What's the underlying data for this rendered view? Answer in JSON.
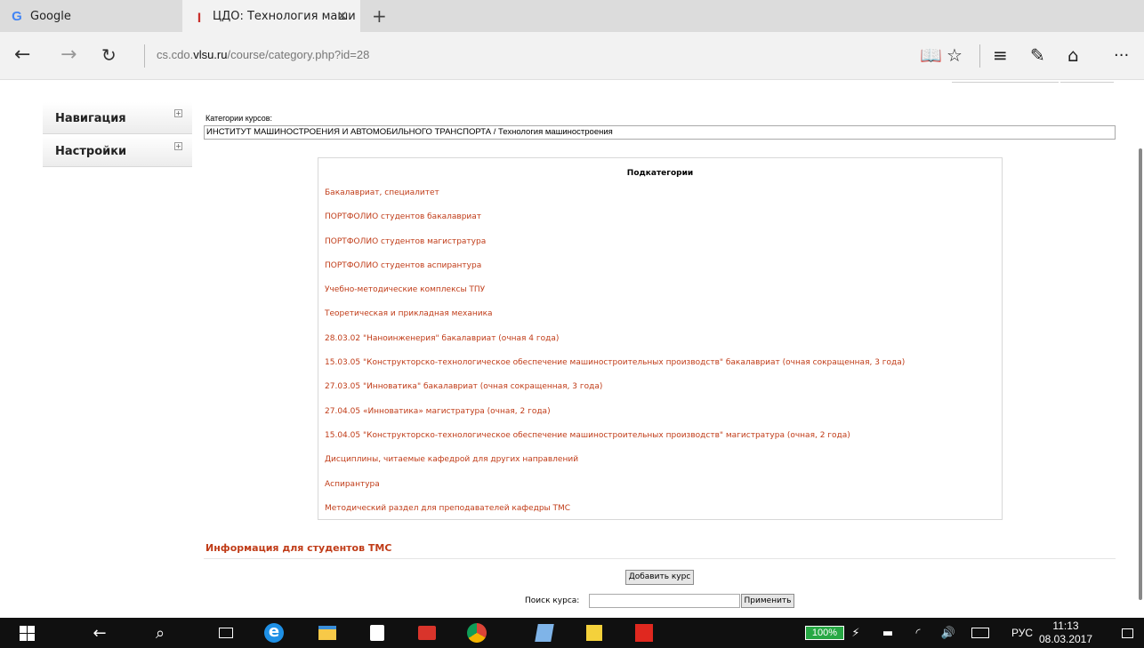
{
  "browser": {
    "tabs": [
      {
        "label": "Google",
        "active": false,
        "icon": "google-g-icon"
      },
      {
        "label": "ЦДО: Технология маши",
        "active": true,
        "icon": "cdo-icon"
      }
    ],
    "url_prefix": "cs.cdo.",
    "url_domain": "vlsu.ru",
    "url_path": "/course/category.php?id=28"
  },
  "blocks": {
    "navigation": "Навигация",
    "settings": "Настройки"
  },
  "category": {
    "label": "Категории курсов:",
    "selected": "ИНСТИТУТ МАШИНОСТРОЕНИЯ И АВТОМОБИЛЬНОГО ТРАНСПОРТА / Технология машиностроения"
  },
  "subcategories": {
    "heading": "Подкатегории",
    "items": [
      "Бакалавриат, специалитет",
      "ПОРТФОЛИО студентов бакалавриат",
      "ПОРТФОЛИО студентов магистратура",
      "ПОРТФОЛИО студентов аспирантура",
      "Учебно-методические комплексы ТПУ",
      "Теоретическая и прикладная механика",
      "28.03.02 \"Наноинженерия\" бакалавриат (очная 4 года)",
      "15.03.05 \"Конструкторско-технологическое обеспечение машиностроительных производств\" бакалавриат (очная сокращенная, 3 года)",
      "27.03.05 \"Инноватика\" бакалавриат (очная сокращенная, 3 года)",
      "27.04.05 «Инноватика» магистратура (очная, 2 года)",
      "15.04.05 \"Конструкторско-технологическое обеспечение машиностроительных производств\" магистратура (очная, 2 года)",
      "Дисциплины, читаемые кафедрой для других направлений",
      "Аспирантура",
      "Методический раздел для преподавателей кафедры ТМС"
    ]
  },
  "course_section": {
    "title": "Информация для студентов ТМС",
    "add_course": "Добавить курс",
    "search_label": "Поиск курса:",
    "search_value": "",
    "apply": "Применить"
  },
  "taskbar": {
    "battery": "100%",
    "lang": "РУС",
    "time": "11:13",
    "date": "08.03.2017"
  },
  "colors": {
    "link": "#c03c18",
    "taskbar": "#101010",
    "battery": "#27a844"
  }
}
